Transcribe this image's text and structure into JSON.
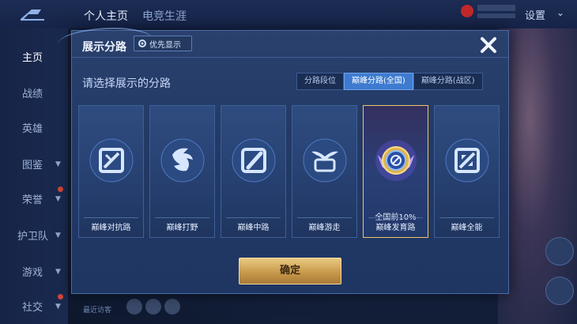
{
  "topbar": {
    "tabs": [
      "个人主页",
      "电竞生涯"
    ],
    "settings_label": "设置"
  },
  "sidebar": {
    "items": [
      "主页",
      "战绩",
      "英雄",
      "图鉴",
      "荣誉",
      "护卫队",
      "游戏",
      "社交"
    ]
  },
  "footer": {
    "recent_visitors": "最近访客"
  },
  "modal": {
    "title": "展示分路",
    "priority_button": "优先显示",
    "prompt": "请选择展示的分路",
    "tabs": [
      {
        "label": "分路段位",
        "active": false
      },
      {
        "label": "巅峰分路(全国)",
        "active": true
      },
      {
        "label": "巅峰分路(战区)",
        "active": false
      }
    ],
    "cards": [
      {
        "label": "巅峰对抗路",
        "icon": "crossed-swords-icon",
        "selected": false
      },
      {
        "label": "巅峰打野",
        "icon": "dragon-icon",
        "selected": false
      },
      {
        "label": "巅峰中路",
        "icon": "slash-staff-icon",
        "selected": false
      },
      {
        "label": "巅峰游走",
        "icon": "shield-wings-icon",
        "selected": false
      },
      {
        "label": "巅峰发育路",
        "icon": "marksman-badge-icon",
        "selected": true,
        "rank": "全国前10%"
      },
      {
        "label": "巅峰全能",
        "icon": "all-round-icon",
        "selected": false
      }
    ],
    "confirm_label": "确定",
    "colors": {
      "accent_tab": "#3e7bd0",
      "selected_border": "#f0c46a",
      "confirm_gold": "#c99a4c"
    }
  }
}
